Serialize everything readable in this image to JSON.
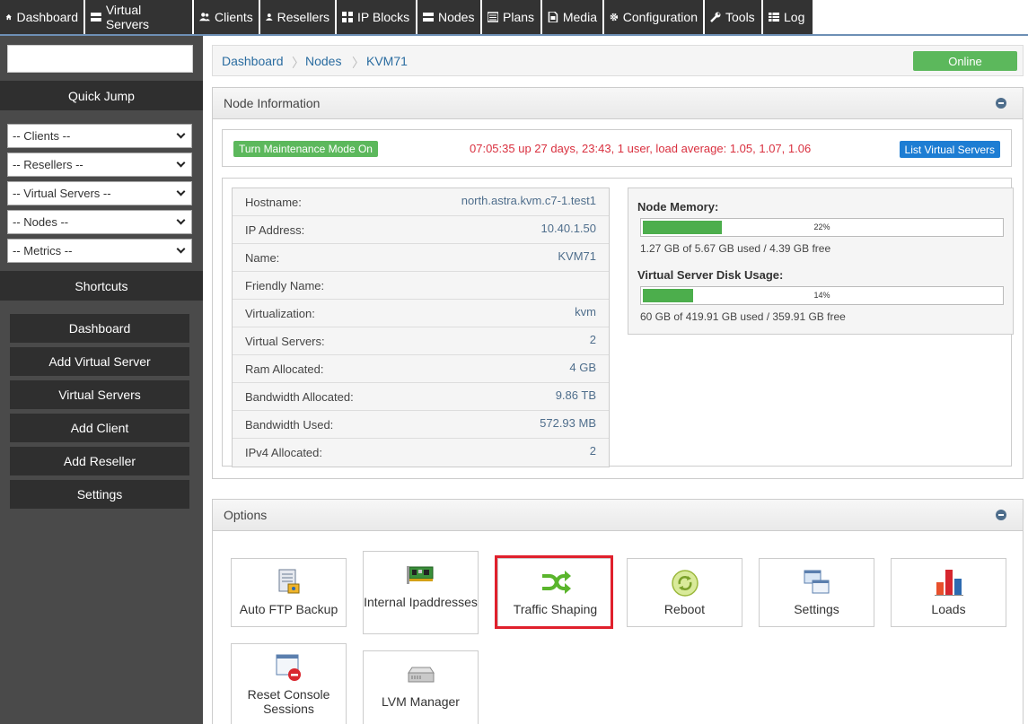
{
  "topnav": [
    {
      "label": "Dashboard",
      "icon": "home-icon"
    },
    {
      "label": "Virtual Servers",
      "icon": "server-icon"
    },
    {
      "label": "Clients",
      "icon": "users-icon"
    },
    {
      "label": "Resellers",
      "icon": "user-icon"
    },
    {
      "label": "IP Blocks",
      "icon": "grid-icon"
    },
    {
      "label": "Nodes",
      "icon": "server-icon"
    },
    {
      "label": "Plans",
      "icon": "list-icon"
    },
    {
      "label": "Media",
      "icon": "file-icon"
    },
    {
      "label": "Configuration",
      "icon": "gear-icon"
    },
    {
      "label": "Tools",
      "icon": "wrench-icon"
    },
    {
      "label": "Log",
      "icon": "table-icon"
    }
  ],
  "sidebar": {
    "search_value": "",
    "quick_jump_title": "Quick Jump",
    "selects": [
      "-- Clients --",
      "-- Resellers --",
      "-- Virtual Servers --",
      "-- Nodes --",
      "-- Metrics --"
    ],
    "shortcuts_title": "Shortcuts",
    "shortcuts": [
      "Dashboard",
      "Add Virtual Server",
      "Virtual Servers",
      "Add Client",
      "Add Reseller",
      "Settings"
    ]
  },
  "breadcrumb": {
    "items": [
      "Dashboard",
      "Nodes",
      "KVM71"
    ],
    "status": "Online",
    "status_color": "#5cb85c"
  },
  "node_info": {
    "title": "Node Information",
    "maintenance_button": "Turn Maintenance Mode On",
    "uptime": "07:05:35 up 27 days, 23:43, 1 user, load average: 1.05, 1.07, 1.06",
    "list_button": "List Virtual Servers",
    "details": [
      {
        "label": "Hostname:",
        "value": "north.astra.kvm.c7-1.test1"
      },
      {
        "label": "IP Address:",
        "value": "10.40.1.50"
      },
      {
        "label": "Name:",
        "value": "KVM71"
      },
      {
        "label": "Friendly Name:",
        "value": ""
      },
      {
        "label": "Virtualization:",
        "value": "kvm"
      },
      {
        "label": "Virtual Servers:",
        "value": "2"
      },
      {
        "label": "Ram Allocated:",
        "value": "4 GB"
      },
      {
        "label": "Bandwidth Allocated:",
        "value": "9.86 TB"
      },
      {
        "label": "Bandwidth Used:",
        "value": "572.93 MB"
      },
      {
        "label": "IPv4 Allocated:",
        "value": "2"
      }
    ],
    "memory": {
      "title": "Node Memory:",
      "percent": 22,
      "percent_label": "22%",
      "detail": "1.27 GB of 5.67 GB used / 4.39 GB free"
    },
    "disk": {
      "title": "Virtual Server Disk Usage:",
      "percent": 14,
      "percent_label": "14%",
      "detail": "60 GB of 419.91 GB used / 359.91 GB free"
    }
  },
  "options": {
    "title": "Options",
    "tiles": [
      {
        "label": "Auto FTP Backup",
        "icon": "ftp-backup-icon"
      },
      {
        "label": "Internal Ipaddresses",
        "icon": "network-card-icon"
      },
      {
        "label": "Traffic Shaping",
        "icon": "shuffle-icon"
      },
      {
        "label": "Reboot",
        "icon": "reboot-icon"
      },
      {
        "label": "Settings",
        "icon": "windows-icon"
      },
      {
        "label": "Loads",
        "icon": "bar-chart-icon"
      },
      {
        "label": "Reset Console Sessions",
        "icon": "console-reset-icon"
      },
      {
        "label": "LVM Manager",
        "icon": "drive-icon"
      }
    ]
  }
}
